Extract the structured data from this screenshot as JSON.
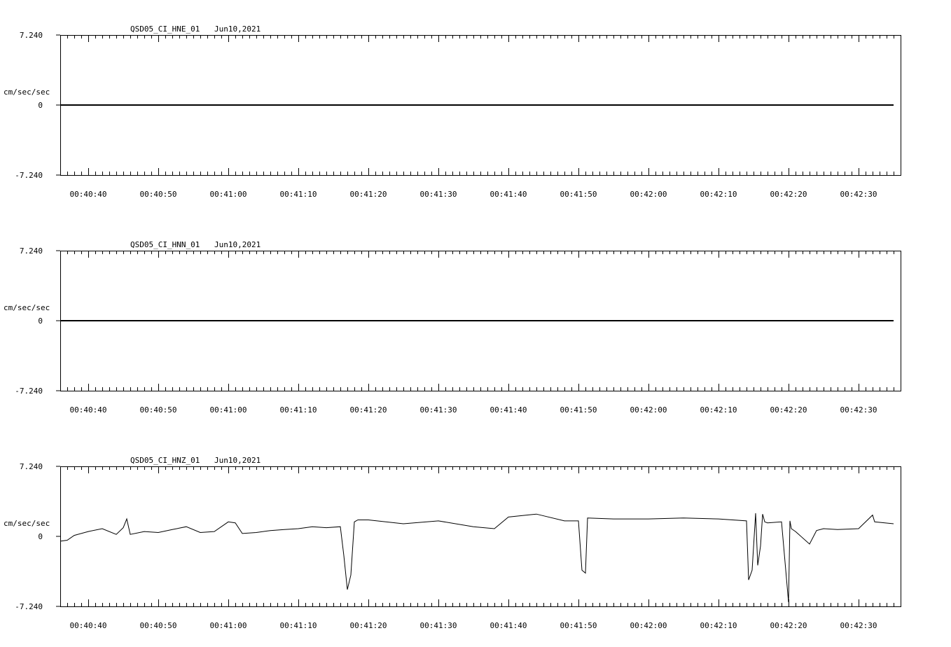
{
  "chart_data": [
    {
      "type": "line",
      "title": "QSD05_CI_HNE_01",
      "date": "Jun10,2021",
      "ylabel": "cm/sec/sec",
      "ylim": [
        -7.24,
        7.24
      ],
      "yticks": [
        "7.240",
        "0",
        "-7.240"
      ],
      "xticks": [
        "00:40:40",
        "00:40:50",
        "00:41:00",
        "00:41:10",
        "00:41:20",
        "00:41:30",
        "00:41:40",
        "00:41:50",
        "00:42:00",
        "00:42:10",
        "00:42:20",
        "00:42:30"
      ],
      "series": [
        {
          "x": [
            "00:40:36",
            "00:42:35"
          ],
          "values": [
            0,
            0
          ]
        }
      ]
    },
    {
      "type": "line",
      "title": "QSD05_CI_HNN_01",
      "date": "Jun10,2021",
      "ylabel": "cm/sec/sec",
      "ylim": [
        -7.24,
        7.24
      ],
      "yticks": [
        "7.240",
        "0",
        "-7.240"
      ],
      "xticks": [
        "00:40:40",
        "00:40:50",
        "00:41:00",
        "00:41:10",
        "00:41:20",
        "00:41:30",
        "00:41:40",
        "00:41:50",
        "00:42:00",
        "00:42:10",
        "00:42:20",
        "00:42:30"
      ],
      "series": [
        {
          "x": [
            "00:40:36",
            "00:42:35"
          ],
          "values": [
            0,
            0
          ]
        }
      ]
    },
    {
      "type": "line",
      "title": "QSD05_CI_HNZ_01",
      "date": "Jun10,2021",
      "ylabel": "cm/sec/sec",
      "ylim": [
        -7.24,
        7.24
      ],
      "yticks": [
        "7.240",
        "0",
        "-7.240"
      ],
      "xticks": [
        "00:40:40",
        "00:40:50",
        "00:41:00",
        "00:41:10",
        "00:41:20",
        "00:41:30",
        "00:41:40",
        "00:41:50",
        "00:42:00",
        "00:42:10",
        "00:42:20",
        "00:42:30"
      ],
      "series": [
        {
          "x": [
            "00:40:36",
            "00:40:37",
            "00:40:38",
            "00:40:40",
            "00:40:42",
            "00:40:44",
            "00:40:45",
            "00:40:45.5",
            "00:40:46",
            "00:40:48",
            "00:40:50",
            "00:40:52",
            "00:40:54",
            "00:40:56",
            "00:40:58",
            "00:41:00",
            "00:41:01",
            "00:41:02",
            "00:41:04",
            "00:41:06",
            "00:41:08",
            "00:41:10",
            "00:41:12",
            "00:41:14",
            "00:41:16",
            "00:41:16.5",
            "00:41:17",
            "00:41:17.5",
            "00:41:18",
            "00:41:18.5",
            "00:41:20",
            "00:41:25",
            "00:41:30",
            "00:41:35",
            "00:41:38",
            "00:41:40",
            "00:41:44",
            "00:41:48",
            "00:41:50",
            "00:41:50.5",
            "00:41:51",
            "00:41:51.3",
            "00:41:55",
            "00:42:00",
            "00:42:05",
            "00:42:10",
            "00:42:14",
            "00:42:14.3",
            "00:42:14.8",
            "00:42:15.3",
            "00:42:15.6",
            "00:42:16",
            "00:42:16.3",
            "00:42:16.6",
            "00:42:17",
            "00:42:19",
            "00:42:20",
            "00:42:20.2",
            "00:42:20.4",
            "00:42:21",
            "00:42:23",
            "00:42:24",
            "00:42:25",
            "00:42:27",
            "00:42:30",
            "00:42:32",
            "00:42:32.3",
            "00:42:35"
          ],
          "values": [
            -0.5,
            -0.4,
            0.1,
            0.5,
            0.8,
            0.2,
            0.9,
            1.8,
            0.2,
            0.5,
            0.4,
            0.7,
            1.0,
            0.4,
            0.5,
            1.5,
            1.4,
            0.3,
            0.4,
            0.6,
            0.7,
            0.8,
            1.0,
            0.9,
            1.0,
            -2.0,
            -5.5,
            -4.0,
            1.5,
            1.7,
            1.7,
            1.3,
            1.6,
            1.0,
            0.8,
            2.0,
            2.3,
            1.6,
            1.6,
            -3.5,
            -3.8,
            1.9,
            1.8,
            1.8,
            1.9,
            1.8,
            1.6,
            -4.5,
            -3.5,
            2.4,
            -3.0,
            -1.0,
            2.3,
            1.5,
            1.4,
            1.5,
            -6.8,
            1.6,
            0.8,
            0.5,
            -0.8,
            0.6,
            0.8,
            0.7,
            0.8,
            2.2,
            1.5,
            1.3
          ]
        }
      ]
    }
  ]
}
